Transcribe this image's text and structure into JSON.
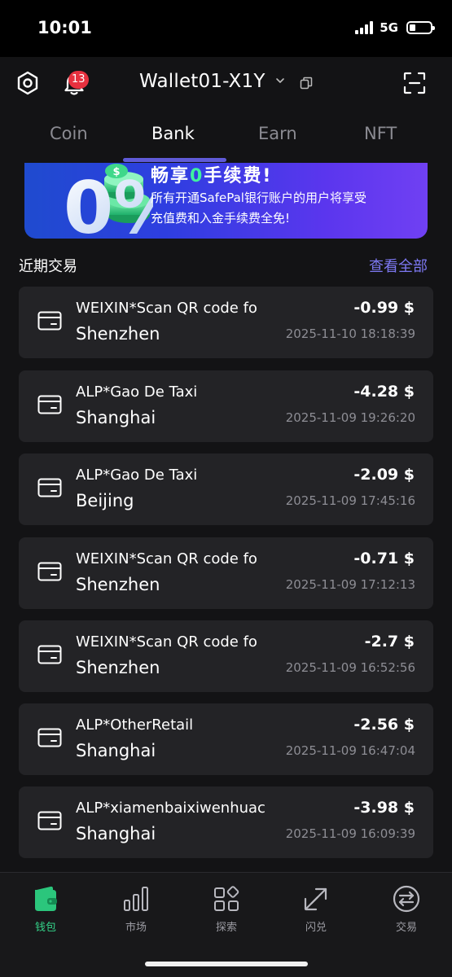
{
  "status_bar": {
    "time": "10:01",
    "network": "5G"
  },
  "header": {
    "notification_count": "13",
    "wallet_name": "Wallet01-X1Y"
  },
  "tabs": [
    {
      "label": "Coin"
    },
    {
      "label": "Bank"
    },
    {
      "label": "Earn"
    },
    {
      "label": "NFT"
    }
  ],
  "active_tab": "Bank",
  "banner": {
    "title_prefix": "畅享",
    "title_zero": "0",
    "title_suffix": "手续费!",
    "line1": "所有开通SafePal银行账户的用户将享受",
    "line2": "充值费和入金手续费全免!",
    "art_text": "0%"
  },
  "recent": {
    "title": "近期交易",
    "view_all": "查看全部"
  },
  "transactions": [
    {
      "merchant": "WEIXIN*Scan QR code fo",
      "city": "Shenzhen",
      "amount": "-0.99 $",
      "date": "2025-11-10 18:18:39"
    },
    {
      "merchant": "ALP*Gao De Taxi",
      "city": "Shanghai",
      "amount": "-4.28 $",
      "date": "2025-11-09 19:26:20"
    },
    {
      "merchant": "ALP*Gao De Taxi",
      "city": "Beijing",
      "amount": "-2.09 $",
      "date": "2025-11-09 17:45:16"
    },
    {
      "merchant": "WEIXIN*Scan QR code fo",
      "city": "Shenzhen",
      "amount": "-0.71 $",
      "date": "2025-11-09 17:12:13"
    },
    {
      "merchant": "WEIXIN*Scan QR code fo",
      "city": "Shenzhen",
      "amount": "-2.7 $",
      "date": "2025-11-09 16:52:56"
    },
    {
      "merchant": "ALP*OtherRetail",
      "city": "Shanghai",
      "amount": "-2.56 $",
      "date": "2025-11-09 16:47:04"
    },
    {
      "merchant": "ALP*xiamenbaixiwenhuac",
      "city": "Shanghai",
      "amount": "-3.98 $",
      "date": "2025-11-09 16:09:39"
    }
  ],
  "bottom_nav": [
    {
      "label": "钱包",
      "icon": "wallet-icon"
    },
    {
      "label": "市场",
      "icon": "market-chart-icon"
    },
    {
      "label": "探索",
      "icon": "explore-grid-icon"
    },
    {
      "label": "闪兑",
      "icon": "flash-swap-icon"
    },
    {
      "label": "交易",
      "icon": "trade-icon"
    }
  ],
  "colors": {
    "background": "#131315",
    "card": "#232326",
    "accent": "#5f5ad8",
    "link": "#7d78f2",
    "active_nav": "#34d58a",
    "badge": "#e7313f"
  }
}
